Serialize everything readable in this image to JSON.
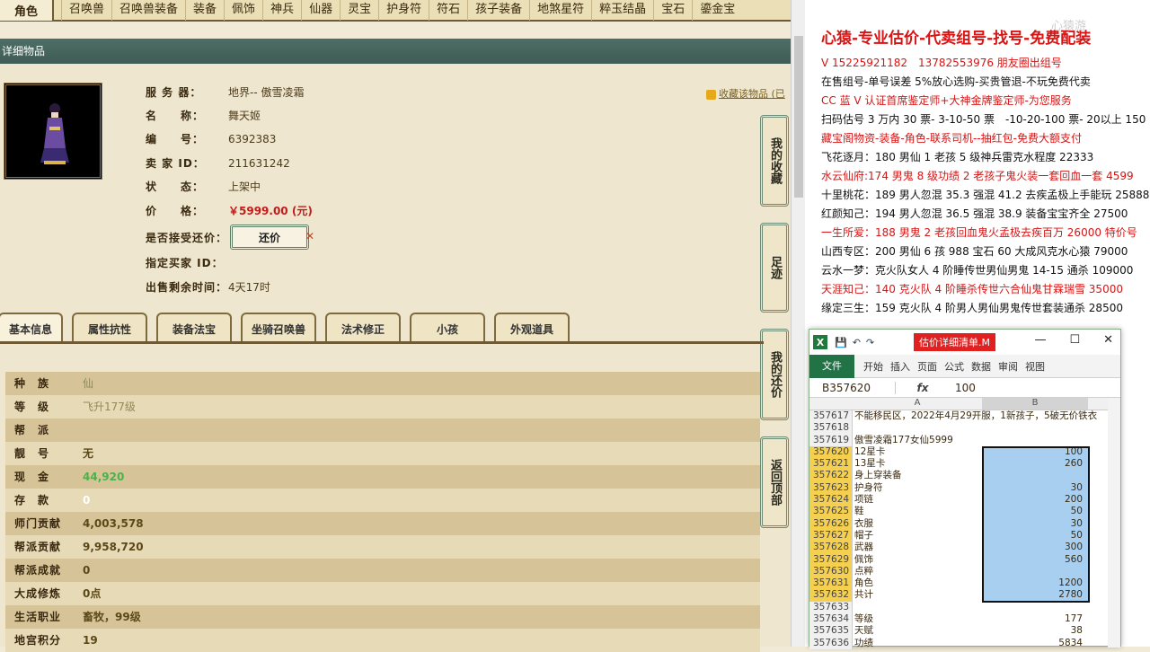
{
  "topnav": {
    "role": "角色",
    "tabs": [
      "召唤兽",
      "召唤兽装备",
      "装备",
      "佩饰",
      "神兵",
      "仙器",
      "灵宝",
      "护身符",
      "符石",
      "孩子装备",
      "地煞星符",
      "粹玉结晶",
      "宝石",
      "鎏金宝"
    ]
  },
  "detail_header": "详细物品",
  "item": {
    "server_label": "服 务 器：",
    "server": "地界-- 傲雪凌霜",
    "name_label": "名　　称：",
    "name": "舞天姬",
    "id_label": "编　　号：",
    "id": "6392383",
    "seller_label": "卖 家  ID：",
    "seller": "211631242",
    "status_label": "状　　态：",
    "status": "上架中",
    "price_label": "价　　格：",
    "price": "￥5999.00 (元)",
    "counter_label": "是否接受还价：",
    "counter_button": "还价",
    "buyer_label": "指定买家 ID：",
    "remaining_label": "出售剩余时间：",
    "remaining": "4天17时",
    "favorite": "收藏该物品 (已"
  },
  "side_buttons": [
    "我的收藏",
    "足迹",
    "我的还价",
    "返回顶部"
  ],
  "subtabs": [
    "基本信息",
    "属性抗性",
    "装备法宝",
    "坐骑召唤兽",
    "法术修正",
    "小孩",
    "外观道具"
  ],
  "attributes": [
    {
      "k": "种　族",
      "v": "仙",
      "style": "dim"
    },
    {
      "k": "等　级",
      "v": "飞升177级",
      "style": "dim"
    },
    {
      "k": "帮　派",
      "v": "",
      "style": ""
    },
    {
      "k": "靓　号",
      "v": "无",
      "style": ""
    },
    {
      "k": "现　金",
      "v": "44,920",
      "style": "green"
    },
    {
      "k": "存　款",
      "v": "0",
      "style": "white"
    },
    {
      "k": "师门贡献",
      "v": "4,003,578",
      "style": ""
    },
    {
      "k": "帮派贡献",
      "v": "9,958,720",
      "style": ""
    },
    {
      "k": "帮派成就",
      "v": "0",
      "style": ""
    },
    {
      "k": "大成修炼",
      "v": "0点",
      "style": ""
    },
    {
      "k": "生活职业",
      "v": "畜牧，99级",
      "style": ""
    },
    {
      "k": "地宫积分",
      "v": "19",
      "style": ""
    }
  ],
  "ad": {
    "title": "心猿-专业估价-代卖组号-找号-免费配装",
    "lines": [
      {
        "t": "V 15225921182　13782553976 朋友圈出组号",
        "red": true
      },
      {
        "t": "在售组号-单号误差 5%放心选购-买贵管退-不玩免费代卖",
        "red": false
      },
      {
        "t": "CC 蓝 V 认证首席鉴定师+大神金牌鉴定师-为您服务",
        "red": true
      },
      {
        "t": "扫码估号 3 万内 30 票- 3-10-50 票　-10-20-100 票- 20以上 150",
        "red": false
      },
      {
        "t": "藏宝阁物资-装备-角色-联系司机--抽红包-免费大额支付",
        "red": true
      },
      {
        "t": "飞花逐月：180 男仙 1 老孩 5 级神兵雷克水程度 22333",
        "red": false
      },
      {
        "t": "水云仙府:174 男鬼 8 级功绩 2 老孩子鬼火装一套回血一套 4599",
        "red": true
      },
      {
        "t": "十里桃花：189 男人忽混 35.3 强混 41.2 去疾孟极上手能玩 25888",
        "red": false
      },
      {
        "t": "红颜知己：194 男人忽混 36.5 强混 38.9 装备宝宝齐全 27500",
        "red": false
      },
      {
        "t": "一生所爱：188 男鬼 2 老孩回血鬼火孟极去疾百万 26000 特价号",
        "red": true
      },
      {
        "t": "山西专区：200 男仙 6 孩 988 宝石 60 大成风克水心猿 79000",
        "red": false
      },
      {
        "t": "云水一梦：克火队女人 4 阶睡传世男仙男鬼 14-15 通杀 109000",
        "red": false
      },
      {
        "t": "天涯知己：140 克火队 4 阶睡杀传世六合仙鬼甘霖瑞雪 35000",
        "red": true
      },
      {
        "t": "缘定三生：159 克火队 4 阶男人男仙男鬼传世套装通杀 28500",
        "red": false
      }
    ],
    "watermark": "心猿游"
  },
  "excel": {
    "title": "估价详细清单.M",
    "file_tab": "文件",
    "ribbon_tabs": [
      "开始",
      "插入",
      "页面",
      "公式",
      "数据",
      "审阅",
      "视图"
    ],
    "name_box": "B357620",
    "formula_value": "100",
    "col_a": "A",
    "col_b": "B",
    "rows": [
      {
        "n": "357617",
        "a": "不能移民区，2022年4月29开服，1新孩子，5破无价铁衣",
        "b": "",
        "sel": false
      },
      {
        "n": "357618",
        "a": "",
        "b": "",
        "sel": false
      },
      {
        "n": "357619",
        "a": "傲雪凌霜177女仙5999",
        "b": "",
        "sel": false
      },
      {
        "n": "357620",
        "a": "12星卡",
        "b": "100",
        "sel": true
      },
      {
        "n": "357621",
        "a": "13星卡",
        "b": "260",
        "sel": true
      },
      {
        "n": "357622",
        "a": "身上穿装备",
        "b": "",
        "sel": true
      },
      {
        "n": "357623",
        "a": "护身符",
        "b": "30",
        "sel": true
      },
      {
        "n": "357624",
        "a": "项链",
        "b": "200",
        "sel": true
      },
      {
        "n": "357625",
        "a": "鞋",
        "b": "50",
        "sel": true
      },
      {
        "n": "357626",
        "a": "衣服",
        "b": "30",
        "sel": true
      },
      {
        "n": "357627",
        "a": "帽子",
        "b": "50",
        "sel": true
      },
      {
        "n": "357628",
        "a": "武器",
        "b": "300",
        "sel": true
      },
      {
        "n": "357629",
        "a": "佩饰",
        "b": "560",
        "sel": true
      },
      {
        "n": "357630",
        "a": "点粹",
        "b": "",
        "sel": true
      },
      {
        "n": "357631",
        "a": "角色",
        "b": "1200",
        "sel": true
      },
      {
        "n": "357632",
        "a": "共计",
        "b": "2780",
        "sel": true
      },
      {
        "n": "357633",
        "a": "",
        "b": "",
        "sel": false
      },
      {
        "n": "357634",
        "a": "等级",
        "b": "177",
        "sel": false
      },
      {
        "n": "357635",
        "a": "天赋",
        "b": "38",
        "sel": false
      },
      {
        "n": "357636",
        "a": "功绩",
        "b": "5834",
        "sel": false
      }
    ]
  }
}
